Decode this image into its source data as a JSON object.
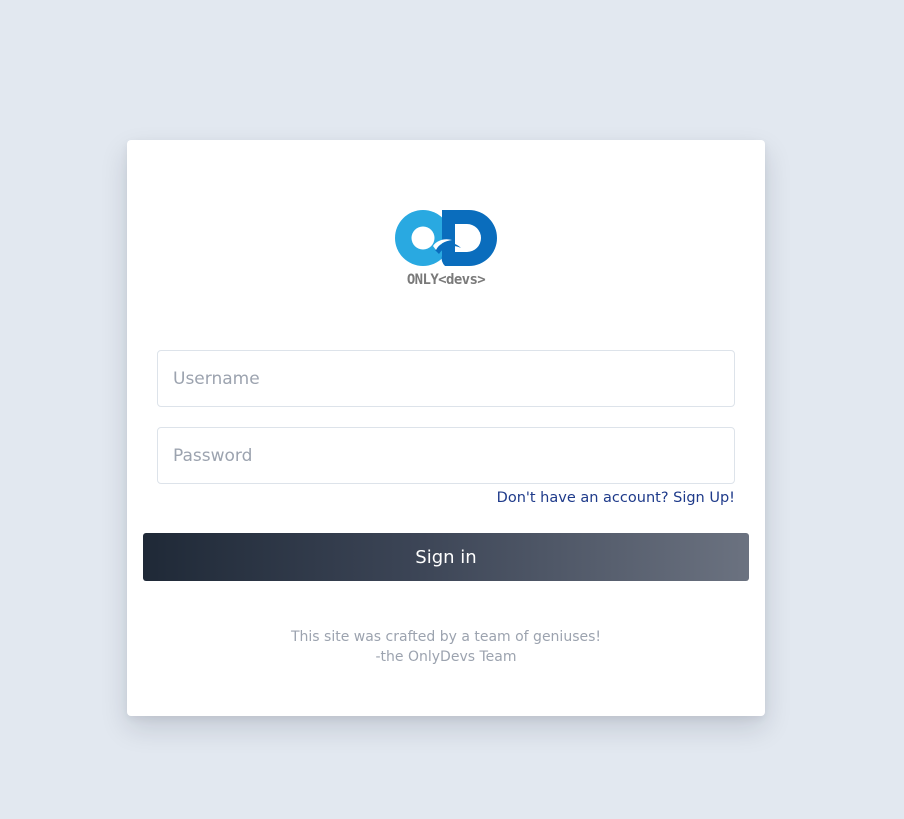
{
  "brand": {
    "logo_text": "ONLY<devs>",
    "colors": {
      "logo_light_blue": "#29a9e1",
      "logo_dark_blue": "#0a6dbd",
      "logo_text": "#7a7a7a"
    }
  },
  "login_form": {
    "username": {
      "placeholder": "Username",
      "value": ""
    },
    "password": {
      "placeholder": "Password",
      "value": ""
    },
    "signup_link_label": "Don't have an account? Sign Up!",
    "signin_button_label": "Sign in"
  },
  "footer": {
    "line1": "This site was crafted by a team of geniuses!",
    "line2": "-the OnlyDevs Team"
  },
  "colors": {
    "page_background": "#e2e8f0",
    "card_background": "#ffffff",
    "link": "#1e3a8a",
    "button_gradient_start": "#1f2937",
    "button_gradient_end": "#6b7280",
    "muted_text": "#9ca3af"
  }
}
